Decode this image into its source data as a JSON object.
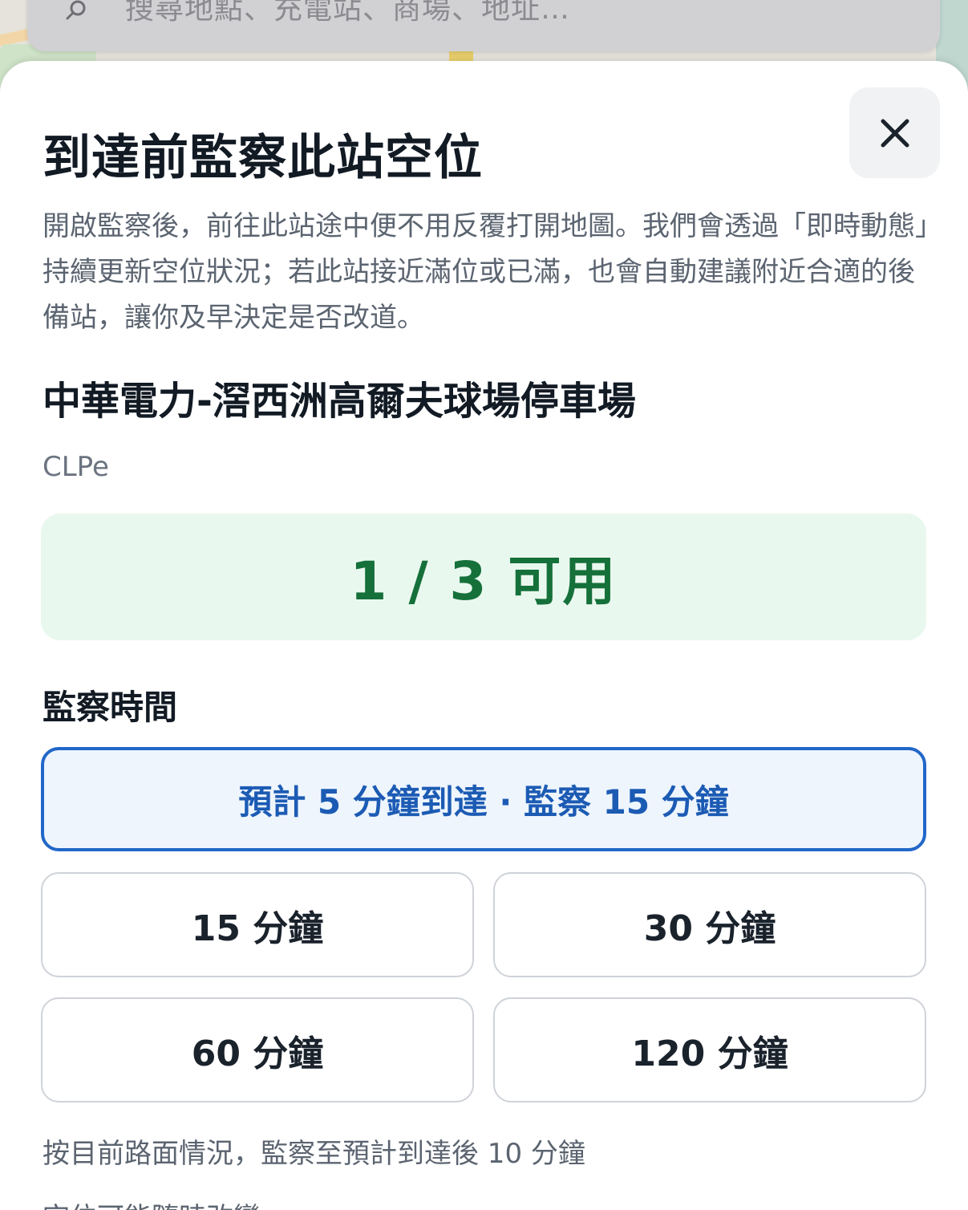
{
  "search": {
    "placeholder": "搜尋地點、充電站、商場、地址…",
    "icon": "search-icon"
  },
  "sheet": {
    "title": "到達前監察此站空位",
    "close_icon": "close-icon",
    "description": "開啟監察後，前往此站途中便不用反覆打開地圖。我們會透過「即時動態」持續更新空位狀況；若此站接近滿位或已滿，也會自動建議附近合適的後備站，讓你及早決定是否改道。",
    "station_name": "中華電力-滘西洲高爾夫球場停車場",
    "operator": "CLPe",
    "availability": {
      "text": "1 / 3 可用",
      "available": 1,
      "total": 3,
      "color": "#15703a",
      "background": "#e9f8ee"
    },
    "monitor_label": "監察時間",
    "options": {
      "recommended": "預計 5 分鐘到達 · 監察 15 分鐘",
      "min15": "15 分鐘",
      "min30": "30 分鐘",
      "min60": "60 分鐘",
      "min120": "120 分鐘"
    },
    "selected_option": "recommended",
    "hint": "按目前路面情況，監察至預計到達後 10 分鐘",
    "hint_cut": "空位可能隨時改變"
  },
  "colors": {
    "accent": "#2267c9",
    "selected_bg": "#eef5fd",
    "title": "#121a24",
    "muted": "#5b6470"
  }
}
